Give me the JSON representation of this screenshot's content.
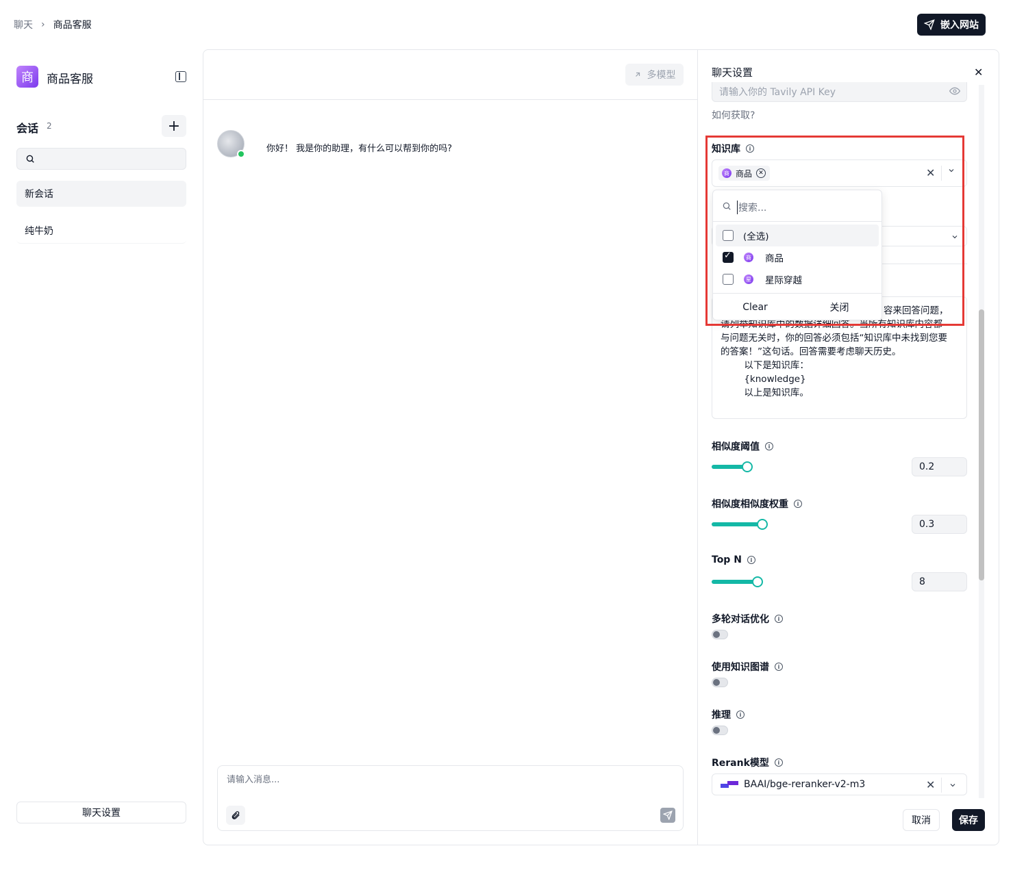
{
  "breadcrumb": {
    "root": "聊天",
    "separator": "›",
    "current": "商品客服"
  },
  "header": {
    "embed_label": "嵌入网站"
  },
  "sidebar": {
    "app_icon_char": "商",
    "app_name": "商品客服",
    "sessions_title": "会话",
    "sessions_count": "2",
    "add_label": "+",
    "search_placeholder": "",
    "sessions": [
      {
        "label": "新会话"
      },
      {
        "label": "纯牛奶"
      }
    ],
    "settings_button": "聊天设置"
  },
  "chat": {
    "multi_model_label": "多模型",
    "greeting": "你好！ 我是你的助理，有什么可以帮到你的吗?",
    "input_placeholder": "请输入消息..."
  },
  "settings": {
    "title": "聊天设置",
    "close": "✕",
    "tavily_placeholder": "请输入你的 Tavily API Key",
    "how_to_get": "如何获取?",
    "knowledge_base_label": "知识库",
    "selected_chip": {
      "icon_char": "商",
      "label": "商品"
    },
    "clear_symbol": "✕",
    "chevron": "⌄",
    "dropdown": {
      "search_placeholder": "搜索...",
      "select_all": "(全选)",
      "items": [
        {
          "icon_char": "商",
          "label": "商品",
          "checked": true
        },
        {
          "icon_char": "星",
          "label": "星际穿越",
          "checked": false
        }
      ],
      "clear": "Clear",
      "close": "关闭"
    },
    "prompt_line1_tail": "容来回答问题，",
    "prompt_line2": "请列举知识库中的数据详细回答。当所有知识库内容都",
    "prompt_rest": "与问题无关时，你的回答必须包括“知识库中未找到您要\n的答案！”这句话。回答需要考虑聊天历史。\n        以下是知识库：\n        {knowledge}\n        以上是知识库。",
    "similarity_threshold": {
      "label": "相似度阈值",
      "value": "0.2",
      "fraction": 0.2
    },
    "similarity_weight": {
      "label": "相似度相似度权重",
      "value": "0.3",
      "fraction": 0.3
    },
    "top_n": {
      "label": "Top N",
      "value": "8",
      "fraction": 0.27
    },
    "multi_turn": {
      "label": "多轮对话优化",
      "on": false
    },
    "knowledge_graph": {
      "label": "使用知识图谱",
      "on": false
    },
    "reasoning": {
      "label": "推理",
      "on": false
    },
    "rerank": {
      "label": "Rerank模型",
      "value": "BAAI/bge-reranker-v2-m3"
    },
    "cancel": "取消",
    "save": "保存"
  },
  "colors": {
    "accent_teal": "#14b8a6",
    "highlight_red": "#e53935",
    "primary_dark": "#111827"
  }
}
